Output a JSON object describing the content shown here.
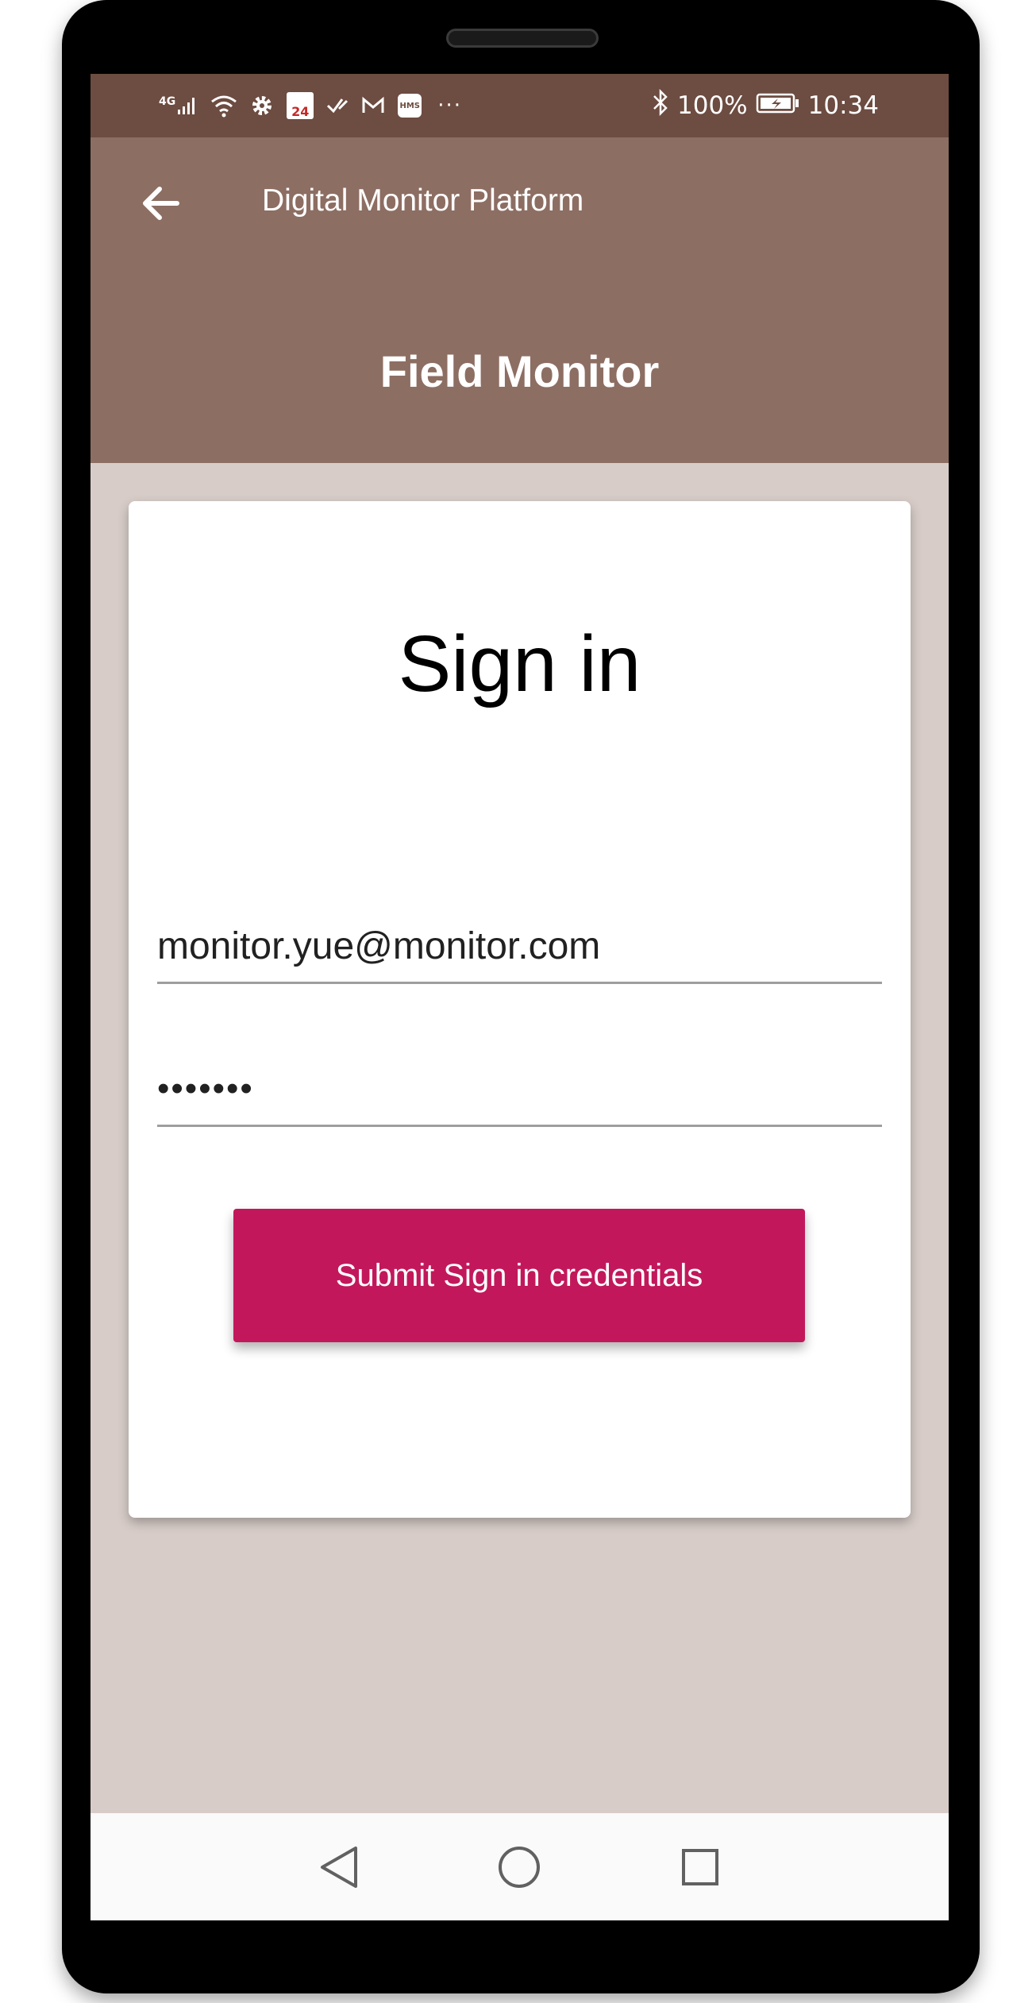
{
  "status_bar": {
    "network": "4G",
    "calendar_date": "24",
    "hms_label": "HMS",
    "battery": "100%",
    "time": "10:34",
    "icons": [
      "signal-icon",
      "wifi-icon",
      "gear-icon",
      "calendar-icon",
      "check-icon",
      "gmail-icon",
      "hms-icon",
      "more-icon",
      "bluetooth-icon",
      "battery-icon"
    ]
  },
  "toolbar": {
    "back_icon": "arrow-left-icon",
    "title": "Digital Monitor Platform"
  },
  "app_bar": {
    "title": "Field Monitor"
  },
  "sign_in": {
    "heading": "Sign in",
    "email_value": "monitor.yue@monitor.com",
    "password_value": "•••••••",
    "submit_label": "Submit Sign in credentials"
  },
  "nav_bar": {
    "icons": [
      "back-triangle-icon",
      "home-circle-icon",
      "recent-square-icon"
    ]
  },
  "colors": {
    "status_bar": "#6d4c41",
    "app_bar": "#8d6e63",
    "background": "#d7ccc8",
    "card": "#ffffff",
    "accent": "#c2185b",
    "nav_bar": "#fafafa"
  }
}
